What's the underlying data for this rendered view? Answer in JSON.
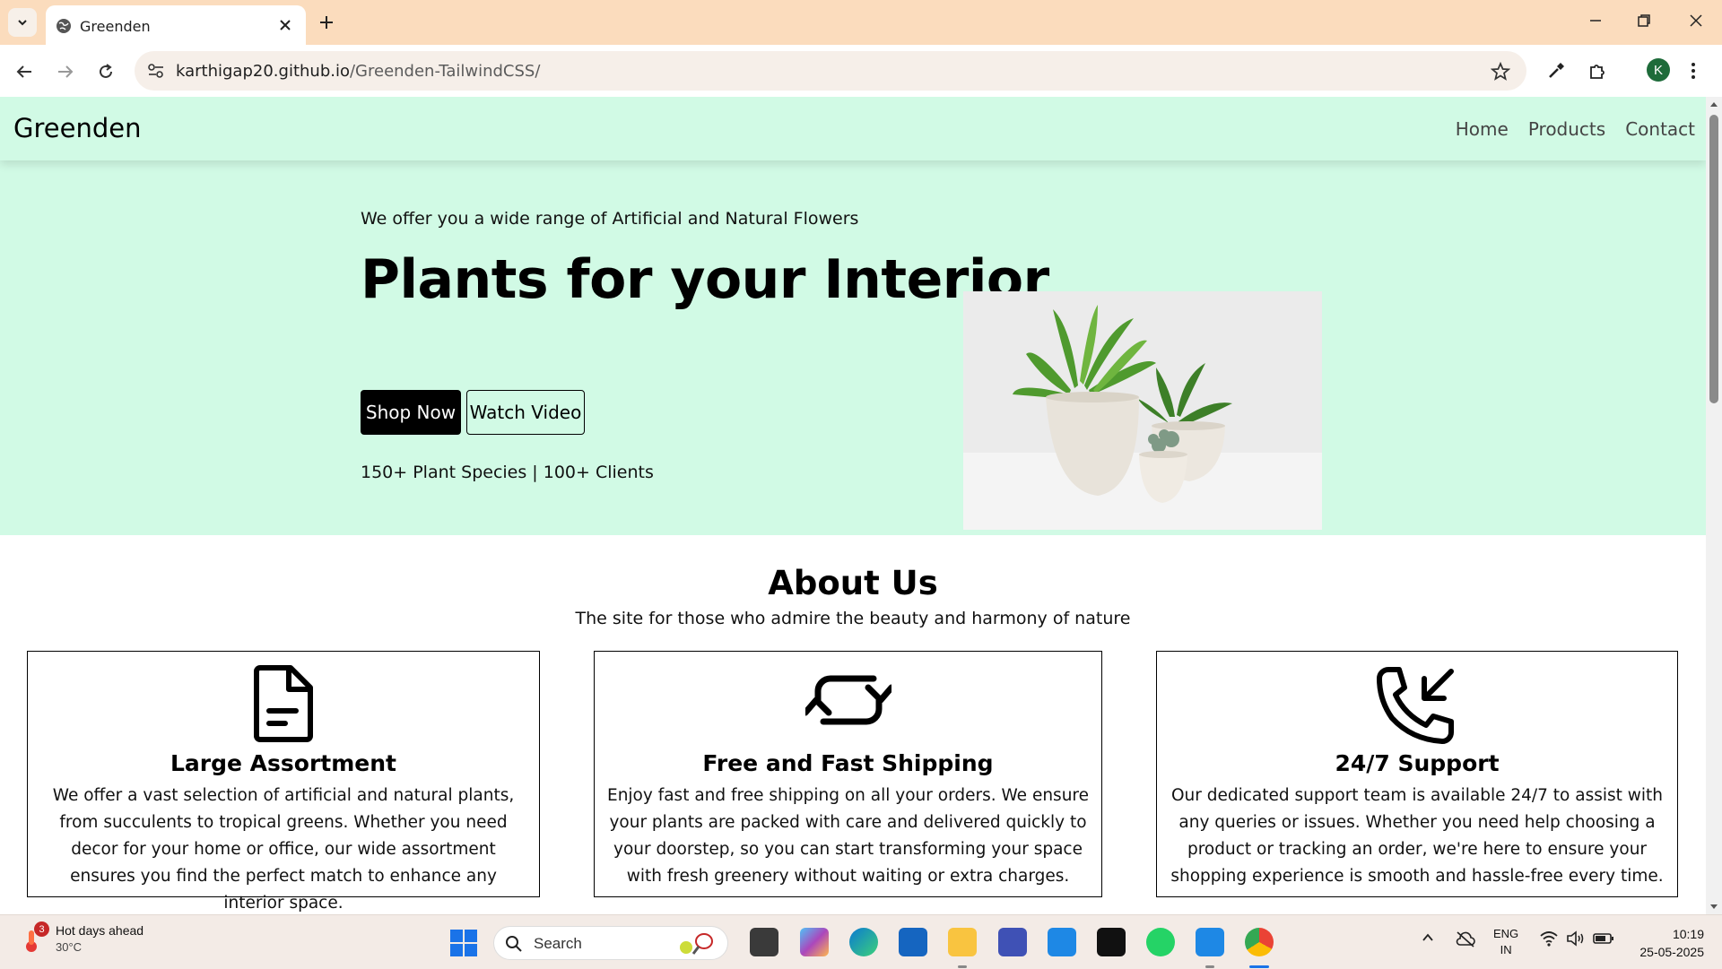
{
  "browser": {
    "tab_title": "Greenden",
    "url_host": "karthigap20.github.io",
    "url_path": "/Greenden-TailwindCSS/",
    "profile_initial": "K"
  },
  "site": {
    "logo": "Greenden",
    "nav": [
      "Home",
      "Products",
      "Contact"
    ],
    "hero": {
      "tagline": "We offer you a wide range of Artificial and Natural Flowers",
      "headline": "Plants for your Interior",
      "primary_button": "Shop Now",
      "secondary_button": "Watch Video",
      "stats": "150+ Plant Species | 100+ Clients"
    },
    "about": {
      "title": "About Us",
      "subtitle": "The site for those who admire the beauty and harmony of nature",
      "cards": [
        {
          "icon": "document-icon",
          "title": "Large Assortment",
          "text": "We offer a vast selection of artificial and natural plants, from succulents to tropical greens. Whether you need decor for your home or office, our wide assortment ensures you find the perfect match to enhance any interior space."
        },
        {
          "icon": "refresh-arrows-icon",
          "title": "Free and Fast Shipping",
          "text": "Enjoy fast and free shipping on all your orders. We ensure your plants are packed with care and delivered quickly to your doorstep, so you can start transforming your space with fresh greenery without waiting or extra charges."
        },
        {
          "icon": "phone-incoming-icon",
          "title": "24/7 Support",
          "text": "Our dedicated support team is available 24/7 to assist with any queries or issues. Whether you need help choosing a product or tracking an order, we're here to ensure your shopping experience is smooth and hassle-free every time."
        }
      ]
    }
  },
  "taskbar": {
    "weather_title": "Hot days ahead",
    "weather_temp": "30°C",
    "weather_badge": "3",
    "search_label": "Search",
    "lang_line1": "ENG",
    "lang_line2": "IN",
    "time": "10:19",
    "date": "25-05-2025"
  },
  "colors": {
    "hero_bg": "#d1fae5",
    "tabbar_bg": "#fbdcbd",
    "button_primary": "#000000"
  }
}
